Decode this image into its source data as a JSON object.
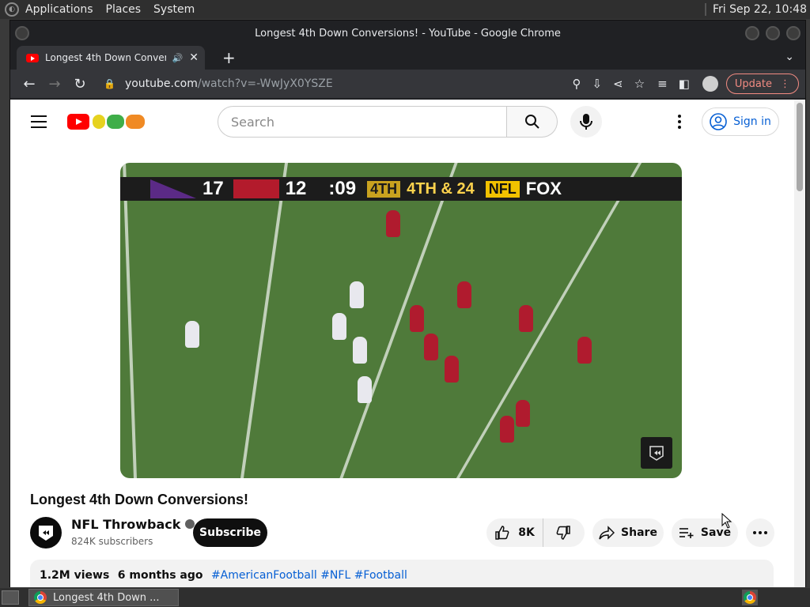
{
  "top_panel": {
    "menus": [
      "Applications",
      "Places",
      "System"
    ],
    "clock": "Fri Sep 22, 10:48"
  },
  "window": {
    "title": "Longest 4th Down Conversions! - YouTube - Google Chrome"
  },
  "tab": {
    "title": "Longest 4th Down Conversions! - YouTube",
    "audio_icon": "speaker-icon",
    "close_label": "✕"
  },
  "toolbar": {
    "url_host": "youtube.com",
    "url_path": "/watch?v=-WwJyX0YSZE",
    "update_label": "Update"
  },
  "youtube": {
    "search_placeholder": "Search",
    "signin_label": "Sign in",
    "video": {
      "scoreboard": {
        "score1": "17",
        "score2": "12",
        "clock": ":09",
        "quarter": "4TH",
        "down": "4TH & 24",
        "network": "FOX"
      },
      "title": "Longest 4th Down Conversions!",
      "channel": "NFL Throwback",
      "subscribers": "824K subscribers",
      "subscribe_label": "Subscribe",
      "likes": "8K",
      "share_label": "Share",
      "save_label": "Save",
      "views": "1.2M views",
      "age": "6 months ago",
      "tags": [
        "#AmericanFootball",
        "#NFL",
        "#Football"
      ]
    }
  },
  "taskbar": {
    "task_label": "Longest 4th Down ..."
  },
  "colors": {
    "youtube_red": "#ff0000",
    "link_blue": "#065fd4",
    "update_red": "#f28b82"
  }
}
